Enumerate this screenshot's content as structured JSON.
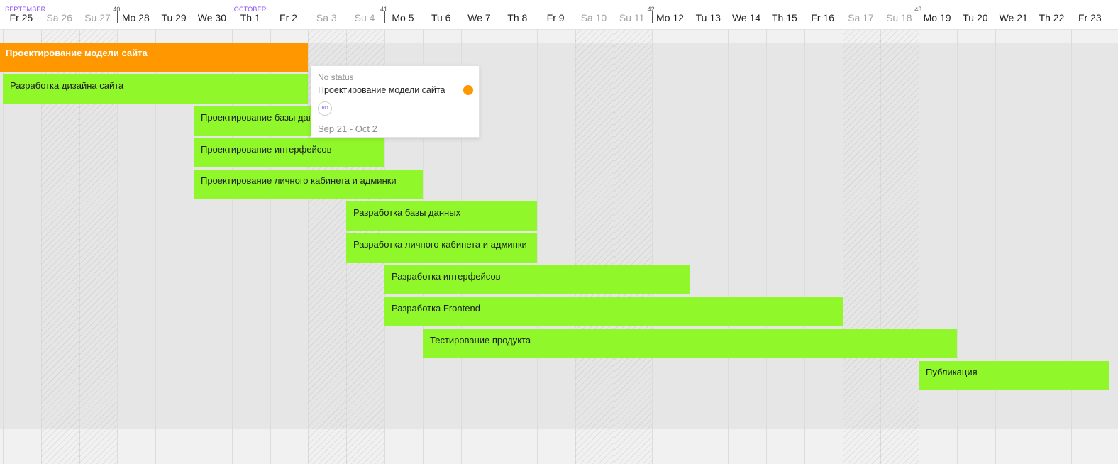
{
  "header": {
    "months": [
      {
        "label": "SEPTEMBER",
        "day_index": 0
      },
      {
        "label": "OCTOBER",
        "day_index": 6
      }
    ],
    "weeks": [
      {
        "number": "40",
        "day_index": 3
      },
      {
        "number": "41",
        "day_index": 10
      },
      {
        "number": "42",
        "day_index": 17
      },
      {
        "number": "43",
        "day_index": 24
      }
    ],
    "days": [
      {
        "label": "Fr 25",
        "weekend": false
      },
      {
        "label": "Sa 26",
        "weekend": true
      },
      {
        "label": "Su 27",
        "weekend": true
      },
      {
        "label": "Mo 28",
        "weekend": false
      },
      {
        "label": "Tu 29",
        "weekend": false
      },
      {
        "label": "We 30",
        "weekend": false
      },
      {
        "label": "Th 1",
        "weekend": false
      },
      {
        "label": "Fr 2",
        "weekend": false
      },
      {
        "label": "Sa 3",
        "weekend": true
      },
      {
        "label": "Su 4",
        "weekend": true
      },
      {
        "label": "Mo 5",
        "weekend": false
      },
      {
        "label": "Tu 6",
        "weekend": false
      },
      {
        "label": "We 7",
        "weekend": false
      },
      {
        "label": "Th 8",
        "weekend": false
      },
      {
        "label": "Fr 9",
        "weekend": false
      },
      {
        "label": "Sa 10",
        "weekend": true
      },
      {
        "label": "Su 11",
        "weekend": true
      },
      {
        "label": "Mo 12",
        "weekend": false
      },
      {
        "label": "Tu 13",
        "weekend": false
      },
      {
        "label": "We 14",
        "weekend": false
      },
      {
        "label": "Th 15",
        "weekend": false
      },
      {
        "label": "Fr 16",
        "weekend": false
      },
      {
        "label": "Sa 17",
        "weekend": true
      },
      {
        "label": "Su 18",
        "weekend": true
      },
      {
        "label": "Mo 19",
        "weekend": false
      },
      {
        "label": "Tu 20",
        "weekend": false
      },
      {
        "label": "We 21",
        "weekend": false
      },
      {
        "label": "Th 22",
        "weekend": false
      },
      {
        "label": "Fr 23",
        "weekend": false
      }
    ]
  },
  "tasks": [
    {
      "label": "Проектирование модели сайта",
      "start": "Sep 21",
      "end": "Oct 2",
      "color": "#ff9800"
    },
    {
      "label": "Разработка дизайна сайта",
      "start": "Sep 25",
      "end": "Oct 2",
      "color": "#90f72b"
    },
    {
      "label": "Проектирование базы данных",
      "start": "Sep 30",
      "end": "Oct 3",
      "color": "#90f72b"
    },
    {
      "label": "Проектирование интерфейсов",
      "start": "Sep 30",
      "end": "Oct 4",
      "color": "#90f72b"
    },
    {
      "label": "Проектирование личного кабинета и админки",
      "start": "Sep 30",
      "end": "Oct 5",
      "color": "#90f72b"
    },
    {
      "label": "Разработка базы данных",
      "start": "Oct 4",
      "end": "Oct 8",
      "color": "#90f72b"
    },
    {
      "label": "Разработка личного кабинета и админки",
      "start": "Oct 4",
      "end": "Oct 8",
      "color": "#90f72b"
    },
    {
      "label": "Разработка интерфейсов",
      "start": "Oct 5",
      "end": "Oct 12",
      "color": "#90f72b"
    },
    {
      "label": "Разработка Frontend",
      "start": "Oct 5",
      "end": "Oct 16",
      "color": "#90f72b"
    },
    {
      "label": "Тестирование продукта",
      "start": "Oct 6",
      "end": "Oct 19",
      "color": "#90f72b"
    },
    {
      "label": "Публикация",
      "start": "Oct 19",
      "end": "Oct 23",
      "color": "#90f72b"
    }
  ],
  "tooltip": {
    "status": "No status",
    "title": "Проектирование модели сайта",
    "status_color": "#ff9800",
    "avatar_initials": "RO",
    "dates": "Sep 21 - Oct 2"
  }
}
